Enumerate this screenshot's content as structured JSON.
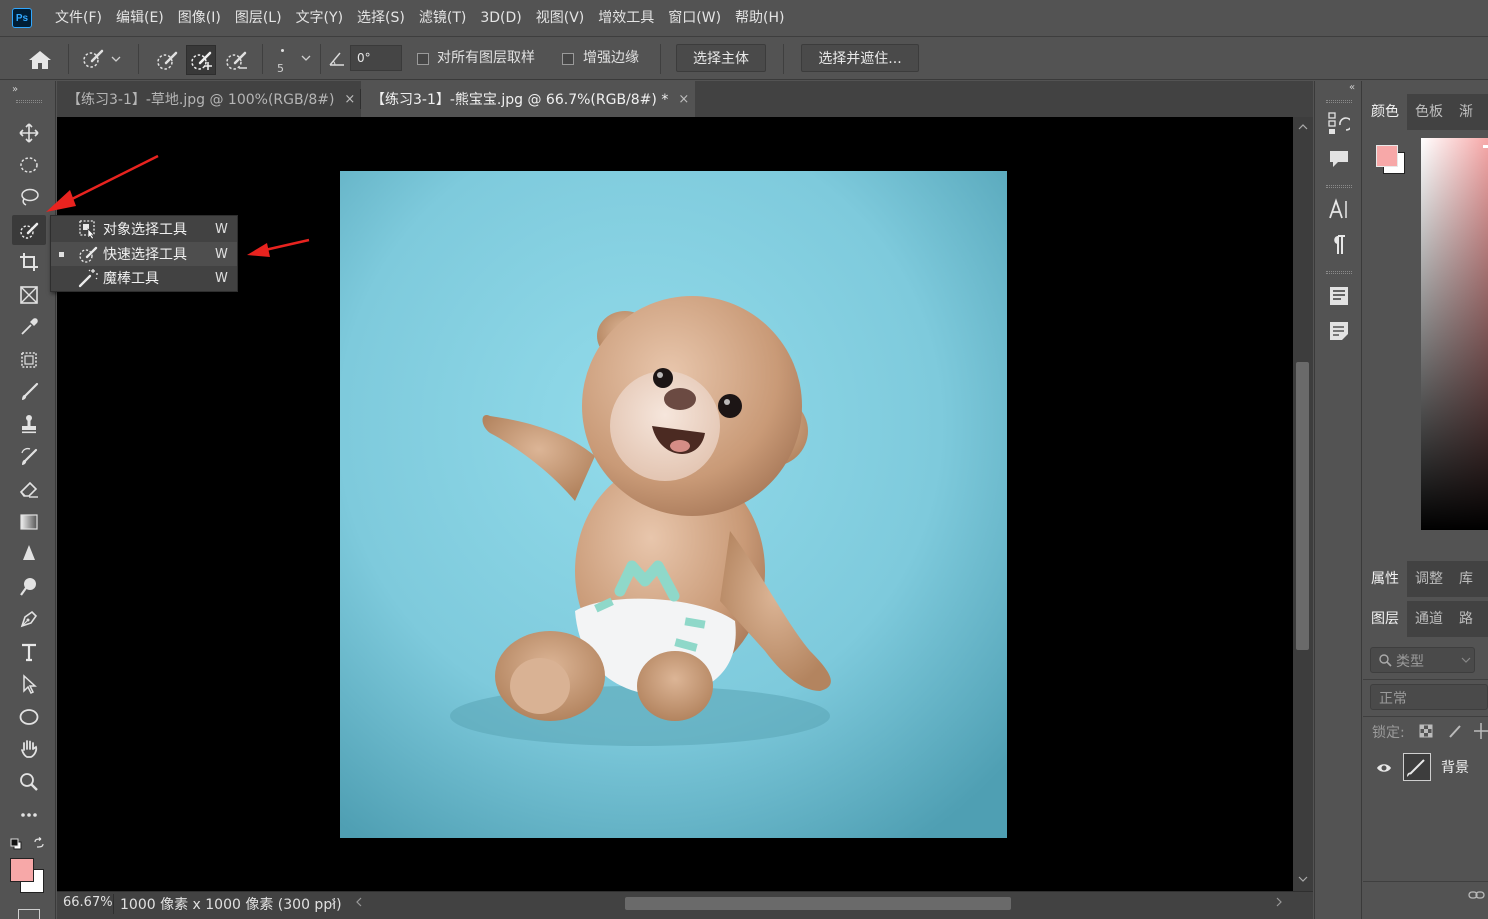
{
  "app": {
    "logo": "Ps"
  },
  "menu": [
    "文件(F)",
    "编辑(E)",
    "图像(I)",
    "图层(L)",
    "文字(Y)",
    "选择(S)",
    "滤镜(T)",
    "3D(D)",
    "视图(V)",
    "增效工具",
    "窗口(W)",
    "帮助(H)"
  ],
  "options": {
    "brush_size": "5",
    "angle_value": "0°",
    "sample_all_layers": "对所有图层取样",
    "enhance_edge": "增强边缘",
    "select_subject": "选择主体",
    "select_and_mask": "选择并遮住..."
  },
  "tabs": [
    {
      "label": "【练习3-1】-草地.jpg @ 100%(RGB/8#)",
      "close": "×"
    },
    {
      "label": "【练习3-1】-熊宝宝.jpg @ 66.7%(RGB/8#) *",
      "close": "×"
    }
  ],
  "flyout": [
    {
      "label": "对象选择工具",
      "key": "W",
      "icon": "object-select-icon",
      "selected": false
    },
    {
      "label": "快速选择工具",
      "key": "W",
      "icon": "quick-select-icon",
      "selected": true
    },
    {
      "label": "魔棒工具",
      "key": "W",
      "icon": "magic-wand-icon",
      "selected": false
    }
  ],
  "status": {
    "zoom": "66.67%",
    "doc_info": "1000 像素 x 1000 像素 (300 ppi)",
    "arrow": "›"
  },
  "colors": {
    "foreground": "#f7a8a8",
    "background": "#ffffff",
    "canvas_bg": "#89d3e3",
    "annotation": "#e8231f"
  },
  "right_panel": {
    "top_tabs": [
      "颜色",
      "色板",
      "渐"
    ],
    "mid_tabs": [
      "属性",
      "调整",
      "库"
    ],
    "layer_tabs": [
      "图层",
      "通道",
      "路"
    ],
    "filter_placeholder": "类型",
    "blend_mode": "正常",
    "lock_label": "锁定:",
    "layer_name": "背景"
  }
}
